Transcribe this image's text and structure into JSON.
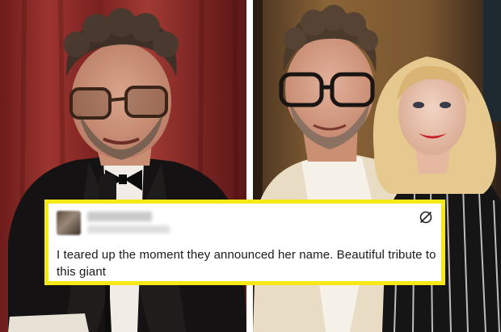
{
  "tweet": {
    "text": "I teared up the moment they announced her name. Beautiful tribute to this giant",
    "logo_icon": "x-logo-icon",
    "author_name": "",
    "author_handle": ""
  },
  "colors": {
    "card_border": "#f5e816",
    "left_background": "#8b2a27",
    "right_background": "#6a4a2a"
  }
}
